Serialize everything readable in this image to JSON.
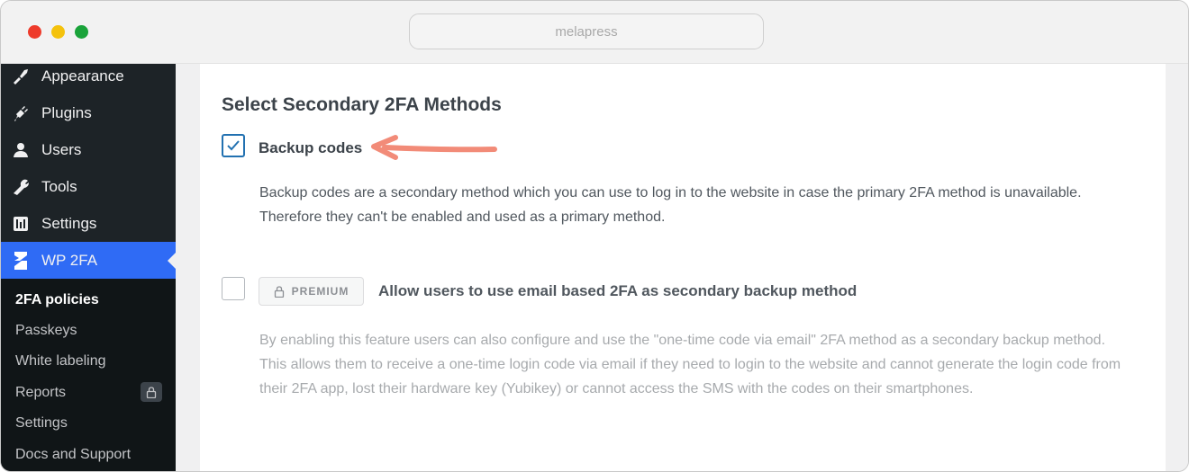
{
  "browser": {
    "url": "melapress"
  },
  "sidebar": {
    "menu": [
      {
        "label": "Appearance",
        "icon": "paintbrush-icon"
      },
      {
        "label": "Plugins",
        "icon": "plug-icon"
      },
      {
        "label": "Users",
        "icon": "user-icon"
      },
      {
        "label": "Tools",
        "icon": "wrench-icon"
      },
      {
        "label": "Settings",
        "icon": "settings-sliders-icon"
      },
      {
        "label": "WP 2FA",
        "icon": "wp2fa-logo-icon",
        "active": true
      }
    ],
    "submenu": [
      {
        "label": "2FA policies",
        "current": true
      },
      {
        "label": "Passkeys"
      },
      {
        "label": "White labeling"
      },
      {
        "label": "Reports",
        "locked": true
      },
      {
        "label": "Settings"
      },
      {
        "label": "Docs and Support"
      }
    ]
  },
  "main": {
    "section_title": "Select Secondary 2FA Methods",
    "options": [
      {
        "label": "Backup codes",
        "checked": true,
        "description": "Backup codes are a secondary method which you can use to log in to the website in case the primary 2FA method is unavailable. Therefore they can't be enabled and used as a primary method."
      },
      {
        "label": "Allow users to use email based 2FA as secondary backup method",
        "checked": false,
        "badge": "PREMIUM",
        "description": "By enabling this feature users can also configure and use the \"one-time code via email\" 2FA method as a secondary backup method. This allows them to receive a one-time login code via email if they need to login to the website and cannot generate the login code from their 2FA app, lost their hardware key (Yubikey) or cannot access the SMS with the codes on their smartphones."
      }
    ]
  },
  "colors": {
    "sidebar_bg": "#1d2327",
    "active_item": "#2f6bf5",
    "checkbox_accent": "#2271b1",
    "annotation_arrow": "#f28b78"
  }
}
